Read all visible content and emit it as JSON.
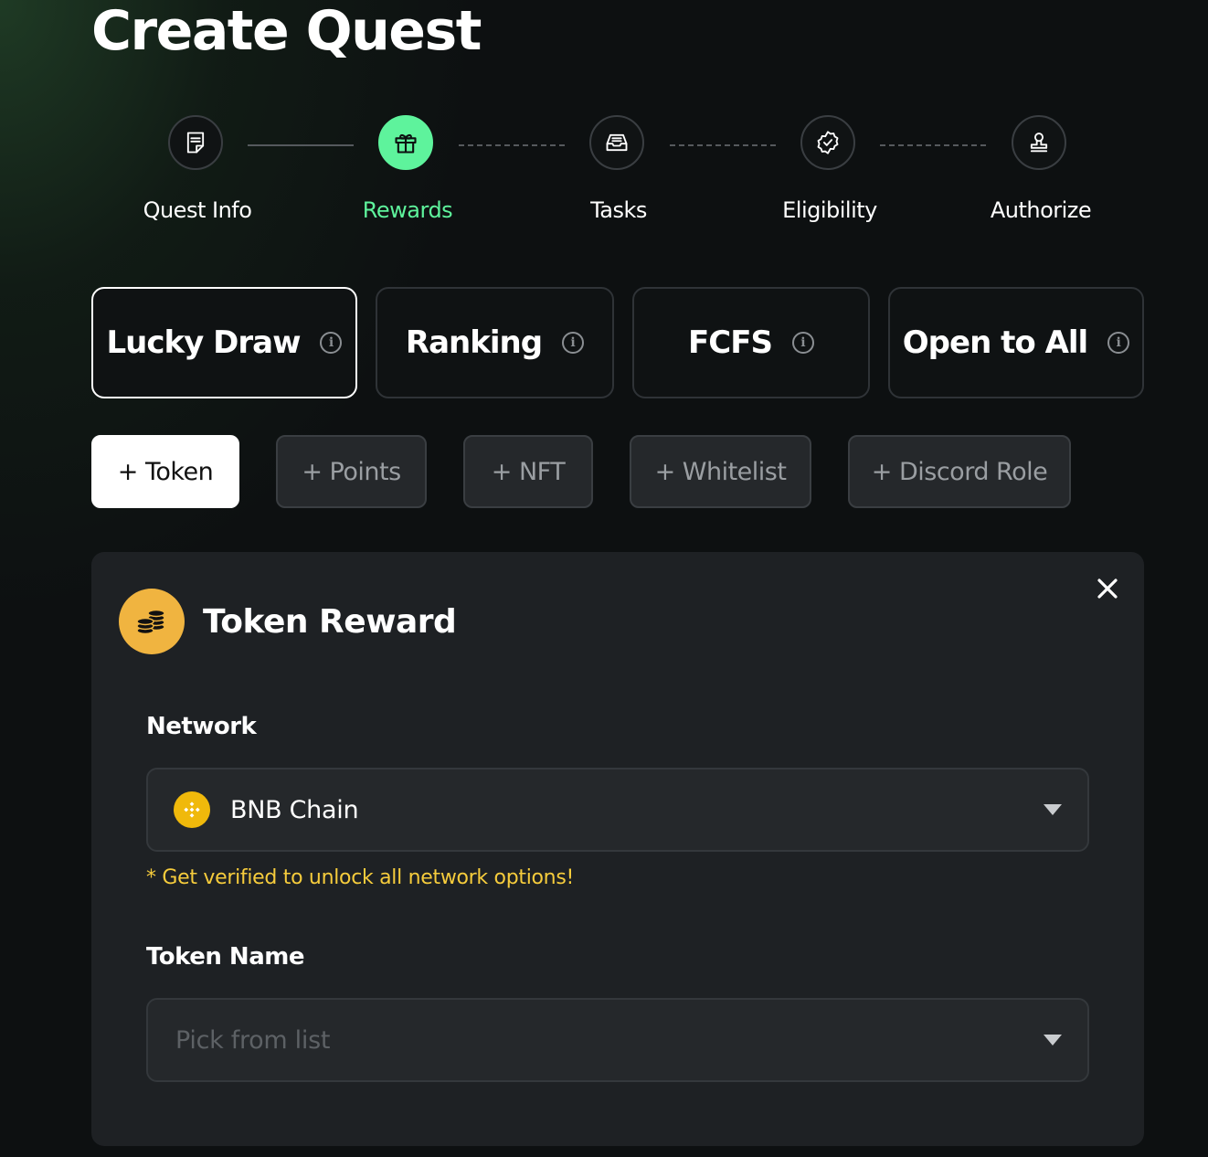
{
  "page": {
    "title": "Create Quest"
  },
  "stepper": {
    "steps": [
      {
        "label": "Quest Info",
        "icon": "document-icon",
        "state": "completed"
      },
      {
        "label": "Rewards",
        "icon": "gift-icon",
        "state": "active"
      },
      {
        "label": "Tasks",
        "icon": "inbox-icon",
        "state": "upcoming"
      },
      {
        "label": "Eligibility",
        "icon": "verified-badge-icon",
        "state": "upcoming"
      },
      {
        "label": "Authorize",
        "icon": "stamp-icon",
        "state": "upcoming"
      }
    ]
  },
  "distribution_types": [
    {
      "label": "Lucky Draw",
      "selected": true
    },
    {
      "label": "Ranking",
      "selected": false
    },
    {
      "label": "FCFS",
      "selected": false
    },
    {
      "label": "Open to All",
      "selected": false
    }
  ],
  "reward_buttons": [
    {
      "label": "+ Token",
      "selected": true
    },
    {
      "label": "+ Points",
      "selected": false
    },
    {
      "label": "+ NFT",
      "selected": false
    },
    {
      "label": "+ Whitelist",
      "selected": false
    },
    {
      "label": "+ Discord Role",
      "selected": false
    }
  ],
  "token_reward": {
    "title": "Token Reward",
    "network_label": "Network",
    "network_value": "BNB Chain",
    "network_notice": "* Get verified to unlock all network options!",
    "token_name_label": "Token Name",
    "token_name_placeholder": "Pick from list"
  },
  "colors": {
    "accent": "#5ef39c",
    "notice": "#f6cc3c",
    "coin": "#f0b440",
    "bnb": "#f0b90b",
    "background": "#0d1011",
    "panel": "#1e2124"
  }
}
